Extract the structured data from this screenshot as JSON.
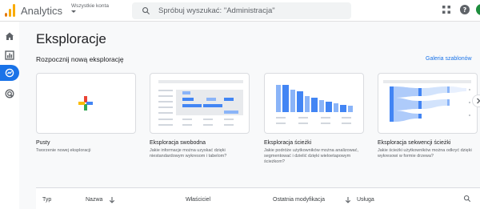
{
  "app": {
    "brand": "Analytics",
    "account_label": "Wszystkie konta",
    "search_placeholder": "Spróbuj wyszukać: \"Administracja\""
  },
  "icons": {
    "apps": "apps-grid-icon",
    "help": "help-icon",
    "search": "search-icon",
    "home": "home-icon",
    "reports": "reports-icon",
    "explore": "explore-icon",
    "advertising": "advertising-icon"
  },
  "colors": {
    "accent": "#1a73e8",
    "logo": [
      "#f9ab00",
      "#e37400"
    ]
  },
  "page": {
    "title": "Eksploracje",
    "section_title": "Rozpocznij nową eksplorację",
    "gallery_link": "Galeria szablonów"
  },
  "cards": [
    {
      "title": "Pusty",
      "description": "Tworzenie nowej eksploracji"
    },
    {
      "title": "Eksploracja swobodna",
      "description": "Jakie informacje można uzyskać dzięki niestandardowym wykresom i tabelom?"
    },
    {
      "title": "Eksploracja ścieżki",
      "description": "Jakie podróże użytkowników można analizować, segmentować i dzielić dzięki wieloetapowym ścieżkom?"
    },
    {
      "title": "Eksploracja sekwencji ścieżki",
      "description": "Jakie ścieżki użytkowników można odkryć dzięki wykresowi w formie drzewa?"
    }
  ],
  "table": {
    "columns": [
      "Typ",
      "Nazwa",
      "Właściciel",
      "Ostatnia modyfikacja",
      "Usługa"
    ]
  }
}
